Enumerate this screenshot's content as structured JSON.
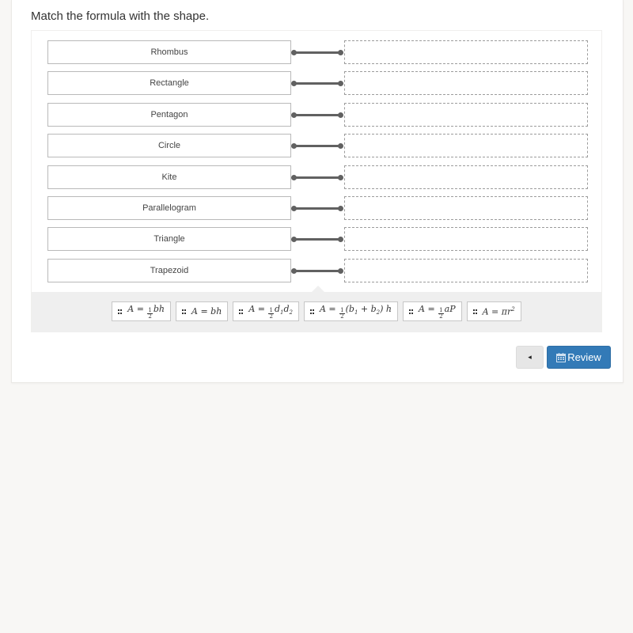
{
  "prompt": "Match the formula with the shape.",
  "shapes": [
    "Rhombus",
    "Rectangle",
    "Pentagon",
    "Circle",
    "Kite",
    "Parallelogram",
    "Triangle",
    "Trapezoid"
  ],
  "drop_targets": [
    "",
    "",
    "",
    "",
    "",
    "",
    "",
    ""
  ],
  "formulas": [
    {
      "id": "half-bh",
      "text": "A = ½bh"
    },
    {
      "id": "bh",
      "text": "A = bh"
    },
    {
      "id": "half-d1d2",
      "text": "A = ½d₁d₂"
    },
    {
      "id": "half-b1b2-h",
      "text": "A = ½(b₁ + b₂) h"
    },
    {
      "id": "half-aP",
      "text": "A = ½aP"
    },
    {
      "id": "pi-r2",
      "text": "A = πr²"
    }
  ],
  "buttons": {
    "back_icon": "◂",
    "review_label": "Review",
    "review_icon": "calendar-icon"
  },
  "colors": {
    "primary": "#337ab7",
    "connector": "#616161",
    "tray": "#efefef"
  }
}
